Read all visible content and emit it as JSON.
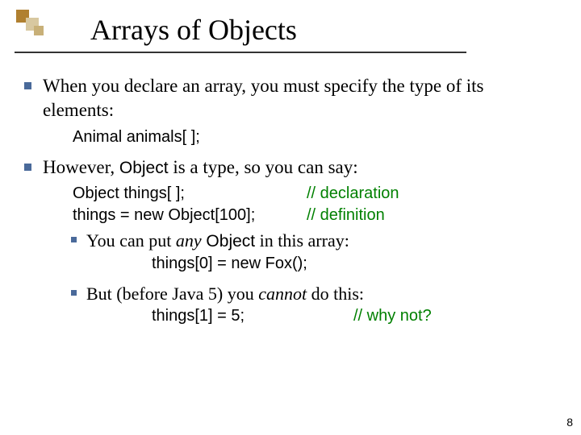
{
  "title": "Arrays of Objects",
  "page_number": "8",
  "bullets": [
    {
      "text_pre": "When you declare an array, you must specify the type of its elements:",
      "code": "Animal animals[ ];"
    },
    {
      "text_pre": "However, ",
      "mono": "Object",
      "text_post": " is a type, so you can say:",
      "code_lines": [
        {
          "left": "Object things[ ];",
          "comment": "// declaration"
        },
        {
          "left": "things = new Object[100];",
          "comment": "// definition"
        }
      ],
      "subs": [
        {
          "pre": "You can put ",
          "em": "any",
          "mono": " Object",
          "post": " in this array:",
          "code": "things[0] = new Fox();"
        },
        {
          "pre": "But (before Java 5) you ",
          "em": "cannot",
          "post": " do this:",
          "code_left": "things[1] = 5;",
          "code_comment": "// why not?"
        }
      ]
    }
  ]
}
